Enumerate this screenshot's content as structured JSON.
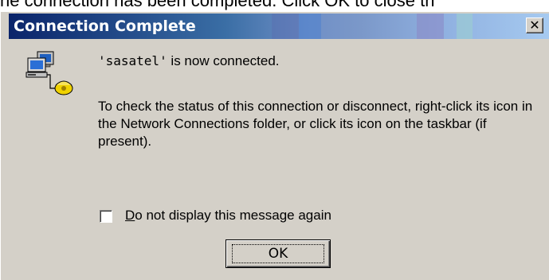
{
  "background_text": "he connection has been completed. Click OK to close th",
  "dialog": {
    "title": "Connection Complete",
    "close_glyph": "✕",
    "icon": "network-connection-icon",
    "connection_name": "'sasatel'",
    "connected_suffix": " is now connected.",
    "instructions": "To check the status of this connection or disconnect, right-click its icon in the Network Connections folder, or click its icon on the taskbar (if present).",
    "checkbox": {
      "label_accel": "D",
      "label_rest": "o not display this message again",
      "checked": false
    },
    "ok_label": "OK"
  },
  "colors": {
    "title_bar_start": "#0a246a",
    "title_bar_end": "#a6caf0",
    "dialog_face": "#d4d0c8"
  }
}
